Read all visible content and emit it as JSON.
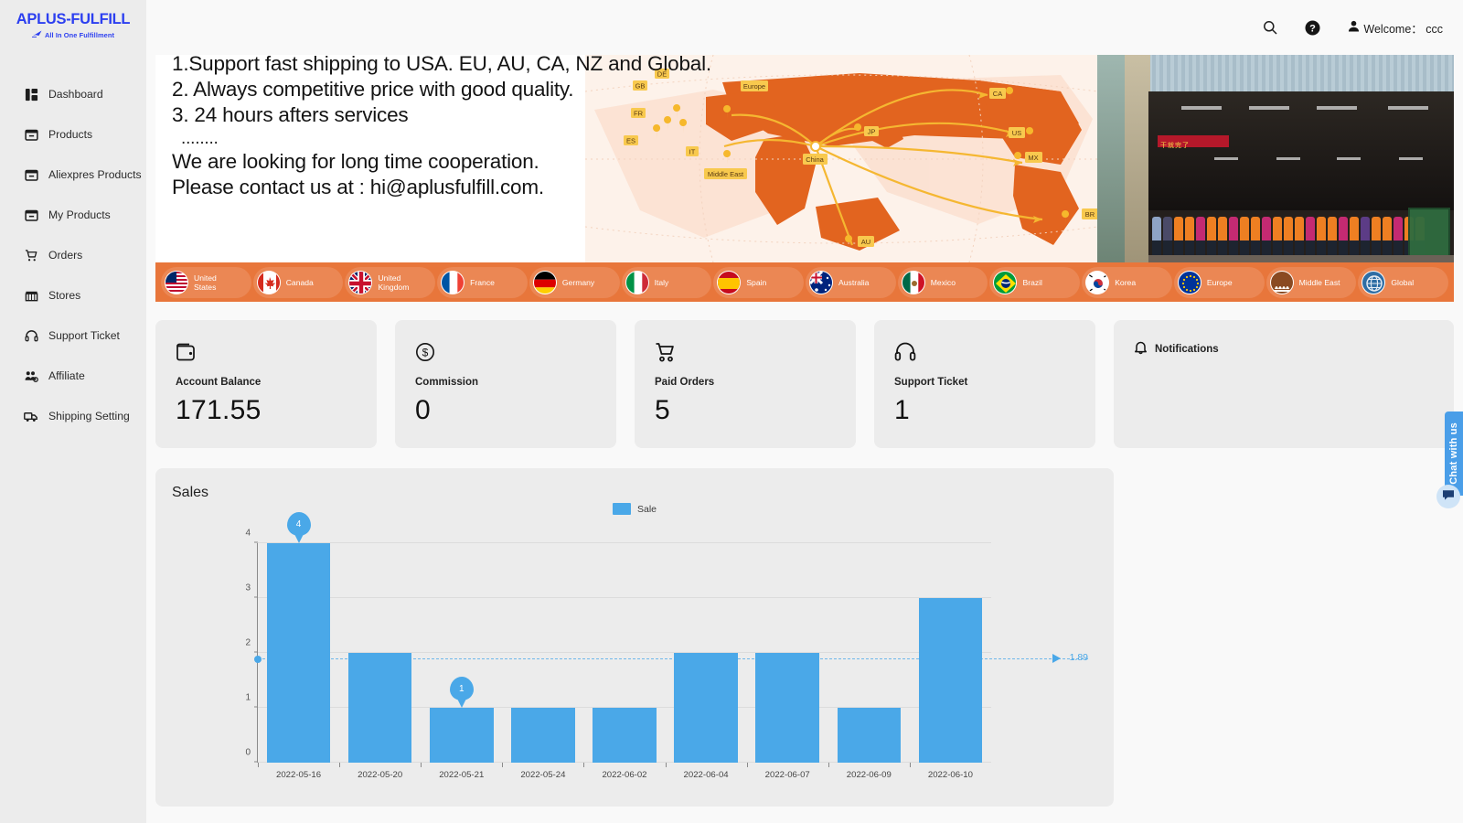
{
  "brand": {
    "name": "APLUS-FULFILL",
    "tagline": "All  In One Fulfillment",
    "logo_color": "#2c3ff0",
    "plane_icon": "plane-icon"
  },
  "topbar": {
    "search_icon": "search-icon",
    "help_icon": "help-circle-icon",
    "user_icon": "user-icon",
    "welcome_text": "Welcome： ccc"
  },
  "sidebar": {
    "items": [
      {
        "label": "Dashboard",
        "icon": "dashboard-icon"
      },
      {
        "label": "Products",
        "icon": "box-icon"
      },
      {
        "label": "Aliexpres Products",
        "icon": "box-icon"
      },
      {
        "label": "My Products",
        "icon": "box-icon"
      },
      {
        "label": "Orders",
        "icon": "cart-icon"
      },
      {
        "label": "Stores",
        "icon": "store-icon"
      },
      {
        "label": "Support Ticket",
        "icon": "headset-icon"
      },
      {
        "label": "Affiliate",
        "icon": "affiliate-icon"
      },
      {
        "label": "Shipping Setting",
        "icon": "truck-icon"
      }
    ]
  },
  "banner": {
    "lines": [
      "1.Support fast shipping to USA. EU, AU, CA, NZ and Global.",
      "2. Always competitive price with good quality.",
      "3. 24 hours afters services"
    ],
    "dots": "........",
    "line_4": "We are looking for long time cooperation.",
    "line_5": "Please contact us at : hi@aplusfulfill.com.",
    "map_labels": [
      "DE",
      "GB",
      "Europe",
      "FR",
      "ES",
      "IT",
      "Middle East",
      "China",
      "JP",
      "CA",
      "US",
      "MX",
      "BR",
      "AU"
    ],
    "accent_color": "#e8763b"
  },
  "flags": [
    {
      "country": "United States",
      "code": "us"
    },
    {
      "country": "Canada",
      "code": "ca"
    },
    {
      "country": "United Kingdom",
      "code": "gb"
    },
    {
      "country": "France",
      "code": "fr"
    },
    {
      "country": "Germany",
      "code": "de"
    },
    {
      "country": "Italy",
      "code": "it"
    },
    {
      "country": "Spain",
      "code": "es"
    },
    {
      "country": "Australia",
      "code": "au"
    },
    {
      "country": "Mexico",
      "code": "mx"
    },
    {
      "country": "Brazil",
      "code": "br"
    },
    {
      "country": "Korea",
      "code": "kr"
    },
    {
      "country": "Europe",
      "code": "eu"
    },
    {
      "country": "Middle East",
      "code": "me"
    },
    {
      "country": "Global",
      "code": "gl"
    }
  ],
  "stats": [
    {
      "label": "Account Balance",
      "value": "171.55",
      "icon": "wallet-icon"
    },
    {
      "label": "Commission",
      "value": "0",
      "icon": "dollar-circle-icon"
    },
    {
      "label": "Paid Orders",
      "value": "5",
      "icon": "cart-icon"
    },
    {
      "label": "Support Ticket",
      "value": "1",
      "icon": "headset-icon"
    }
  ],
  "notifications": {
    "title": "Notifications",
    "icon": "bell-icon",
    "items": []
  },
  "sales": {
    "title": "Sales"
  },
  "chart_data": {
    "type": "bar",
    "title": "Sales",
    "categories": [
      "2022-05-16",
      "2022-05-20",
      "2022-05-21",
      "2022-05-24",
      "2022-06-02",
      "2022-06-04",
      "2022-06-07",
      "2022-06-09",
      "2022-06-10"
    ],
    "values": [
      4,
      2,
      1,
      1,
      1,
      2,
      2,
      1,
      3
    ],
    "series": [
      {
        "name": "Sale",
        "values": [
          4,
          2,
          1,
          1,
          1,
          2,
          2,
          1,
          3
        ]
      }
    ],
    "legend": [
      "Sale"
    ],
    "legend_position": "top-center",
    "xlabel": "",
    "ylabel": "",
    "ylim": [
      0,
      4
    ],
    "yticks": [
      0,
      1,
      2,
      3,
      4
    ],
    "grid": true,
    "bar_color": "#4aa8e8",
    "annotations": [
      {
        "type": "pin",
        "category": "2022-05-16",
        "text": "4"
      },
      {
        "type": "pin",
        "category": "2022-05-21",
        "text": "1"
      },
      {
        "type": "average-line",
        "value": 1.89,
        "label": "1.89"
      }
    ]
  },
  "chat": {
    "tab_label": "Chat with us",
    "bubble_icon": "chat-bubble-icon",
    "accent_color": "#4a9ee8"
  }
}
